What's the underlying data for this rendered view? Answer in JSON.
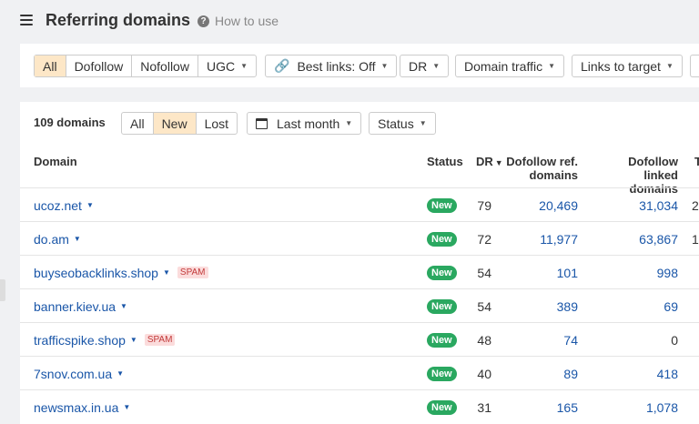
{
  "header": {
    "title": "Referring domains",
    "help_label": "How to use"
  },
  "filters": {
    "link_types": [
      "All",
      "Dofollow",
      "Nofollow",
      "UGC"
    ],
    "best_links": "Best links: Off",
    "dr": "DR",
    "domain_traffic": "Domain traffic",
    "links_to_target": "Links to target"
  },
  "summary": {
    "count": "109 domains",
    "tabs": [
      "All",
      "New",
      "Lost"
    ],
    "period": "Last month",
    "status": "Status"
  },
  "columns": {
    "domain": "Domain",
    "status": "Status",
    "dr": "DR",
    "dof_ref_1": "Dofollow ref.",
    "dof_ref_2": "domains",
    "dof_linked_1": "Dofollow linked",
    "dof_linked_2": "domains",
    "trunc": "T"
  },
  "rows": [
    {
      "domain": "ucoz.net",
      "spam": "",
      "status": "New",
      "dr": "79",
      "dof_ref": "20,469",
      "dof_linked": "31,034",
      "trunc": "2"
    },
    {
      "domain": "do.am",
      "spam": "",
      "status": "New",
      "dr": "72",
      "dof_ref": "11,977",
      "dof_linked": "63,867",
      "trunc": "1"
    },
    {
      "domain": "buyseobacklinks.shop",
      "spam": "SPAM",
      "status": "New",
      "dr": "54",
      "dof_ref": "101",
      "dof_linked": "998",
      "trunc": ""
    },
    {
      "domain": "banner.kiev.ua",
      "spam": "",
      "status": "New",
      "dr": "54",
      "dof_ref": "389",
      "dof_linked": "69",
      "trunc": ""
    },
    {
      "domain": "trafficspike.shop",
      "spam": "SPAM",
      "status": "New",
      "dr": "48",
      "dof_ref": "74",
      "dof_linked": "0",
      "trunc": ""
    },
    {
      "domain": "7snov.com.ua",
      "spam": "",
      "status": "New",
      "dr": "40",
      "dof_ref": "89",
      "dof_linked": "418",
      "trunc": ""
    },
    {
      "domain": "newsmax.in.ua",
      "spam": "",
      "status": "New",
      "dr": "31",
      "dof_ref": "165",
      "dof_linked": "1,078",
      "trunc": ""
    }
  ],
  "colors": {
    "accent": "#fde7c7",
    "link": "#1a56a8",
    "badge": "#2aa860",
    "spam_bg": "#fbdcdc",
    "spam_text": "#c23a3a"
  },
  "icons": [
    "menu-icon",
    "help-icon",
    "link-icon",
    "calendar-icon",
    "chevron-down-icon",
    "sort-down-icon"
  ]
}
